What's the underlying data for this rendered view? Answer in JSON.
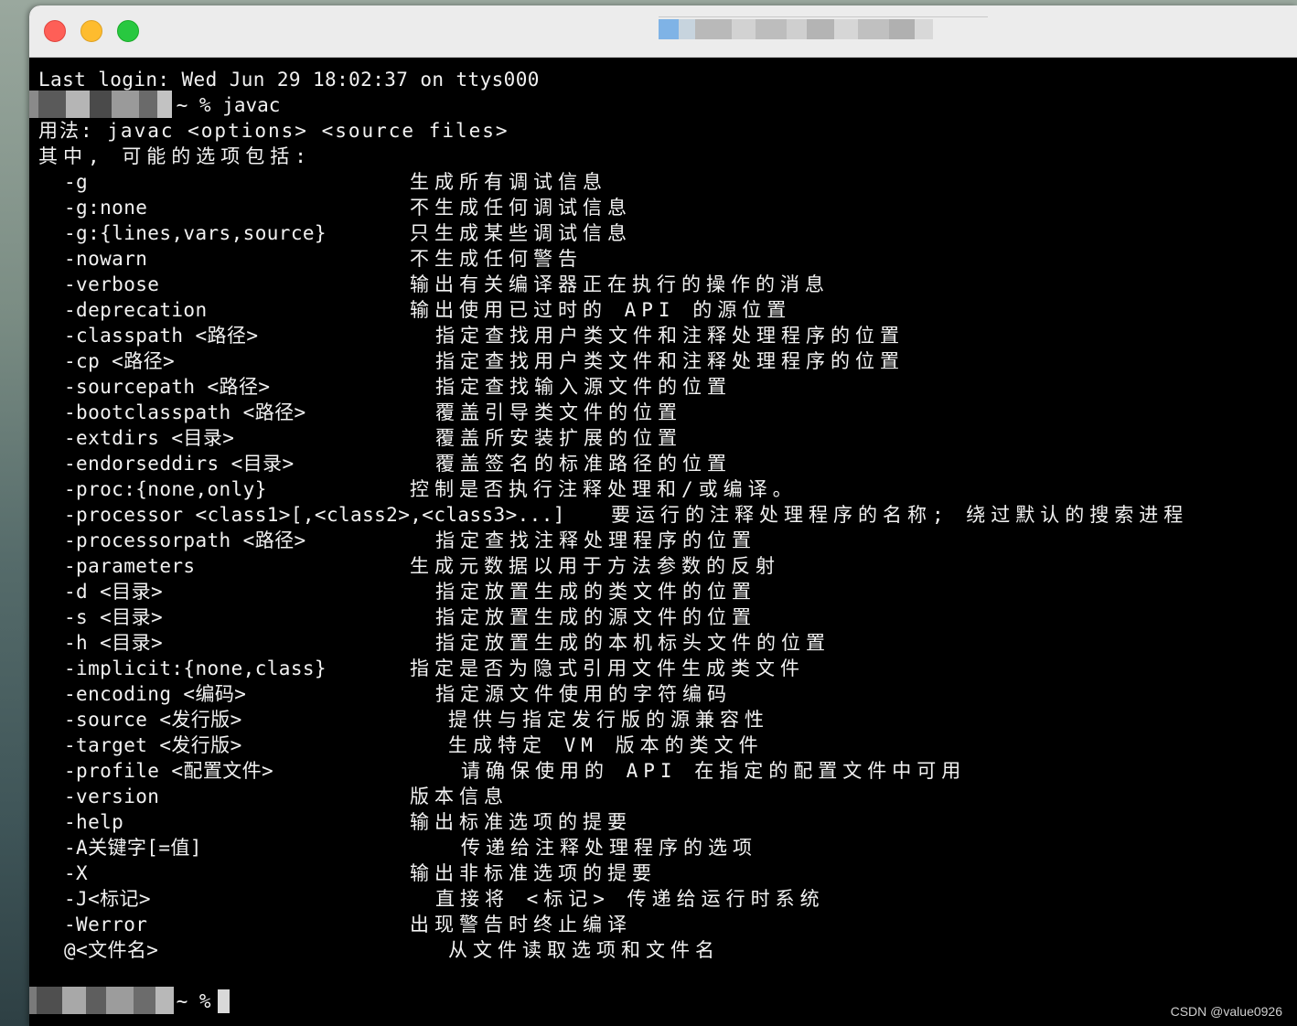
{
  "window": {
    "controls": {
      "close_icon": "close-icon",
      "minimize_icon": "minimize-icon",
      "zoom_icon": "zoom-icon"
    }
  },
  "terminal": {
    "last_login": "Last login: Wed Jun 29 18:02:37 on ttys000",
    "first_prompt_suffix": " ~ % javac",
    "usage": "用法: javac <options> <source files>",
    "intro": "其中, 可能的选项包括:",
    "options": [
      {
        "flag": "-g",
        "description": "生成所有调试信息"
      },
      {
        "flag": "-g:none",
        "description": "不生成任何调试信息"
      },
      {
        "flag": "-g:{lines,vars,source}",
        "description": "只生成某些调试信息"
      },
      {
        "flag": "-nowarn",
        "description": "不生成任何警告"
      },
      {
        "flag": "-verbose",
        "description": "输出有关编译器正在执行的操作的消息"
      },
      {
        "flag": "-deprecation",
        "description": "输出使用已过时的 API 的源位置"
      },
      {
        "flag": "-classpath <路径>",
        "description": "指定查找用户类文件和注释处理程序的位置"
      },
      {
        "flag": "-cp <路径>",
        "description": "指定查找用户类文件和注释处理程序的位置"
      },
      {
        "flag": "-sourcepath <路径>",
        "description": "指定查找输入源文件的位置"
      },
      {
        "flag": "-bootclasspath <路径>",
        "description": "覆盖引导类文件的位置"
      },
      {
        "flag": "-extdirs <目录>",
        "description": "覆盖所安装扩展的位置"
      },
      {
        "flag": "-endorseddirs <目录>",
        "description": "覆盖签名的标准路径的位置"
      },
      {
        "flag": "-proc:{none,only}",
        "description": "控制是否执行注释处理和/或编译。"
      },
      {
        "flag": "-processor <class1>[,<class2>,<class3>...]",
        "description": "要运行的注释处理程序的名称; 绕过默认的搜索进程"
      },
      {
        "flag": "-processorpath <路径>",
        "description": "指定查找注释处理程序的位置"
      },
      {
        "flag": "-parameters",
        "description": "生成元数据以用于方法参数的反射"
      },
      {
        "flag": "-d <目录>",
        "description": "指定放置生成的类文件的位置"
      },
      {
        "flag": "-s <目录>",
        "description": "指定放置生成的源文件的位置"
      },
      {
        "flag": "-h <目录>",
        "description": "指定放置生成的本机标头文件的位置"
      },
      {
        "flag": "-implicit:{none,class}",
        "description": "指定是否为隐式引用文件生成类文件"
      },
      {
        "flag": "-encoding <编码>",
        "description": "指定源文件使用的字符编码"
      },
      {
        "flag": "-source <发行版>",
        "description": "提供与指定发行版的源兼容性"
      },
      {
        "flag": "-target <发行版>",
        "description": "生成特定 VM 版本的类文件"
      },
      {
        "flag": "-profile <配置文件>",
        "description": "请确保使用的 API 在指定的配置文件中可用"
      },
      {
        "flag": "-version",
        "description": "版本信息"
      },
      {
        "flag": "-help",
        "description": "输出标准选项的提要"
      },
      {
        "flag": "-A关键字[=值]",
        "description": "传递给注释处理程序的选项"
      },
      {
        "flag": "-X",
        "description": "输出非标准选项的提要"
      },
      {
        "flag": "-J<标记>",
        "description": "直接将 <标记> 传递给运行时系统"
      },
      {
        "flag": "-Werror",
        "description": "出现警告时终止编译"
      },
      {
        "flag": "@<文件名>",
        "description": "从文件读取选项和文件名"
      }
    ],
    "final_prompt_suffix": " ~ % "
  },
  "watermark": "CSDN @value0926",
  "colors": {
    "terminal_bg": "#000000",
    "terminal_fg": "#f2f2f2",
    "titlebar_bg": "#ececec",
    "close": "#fe5f57",
    "minimize": "#febc2e",
    "zoom": "#28c840"
  }
}
